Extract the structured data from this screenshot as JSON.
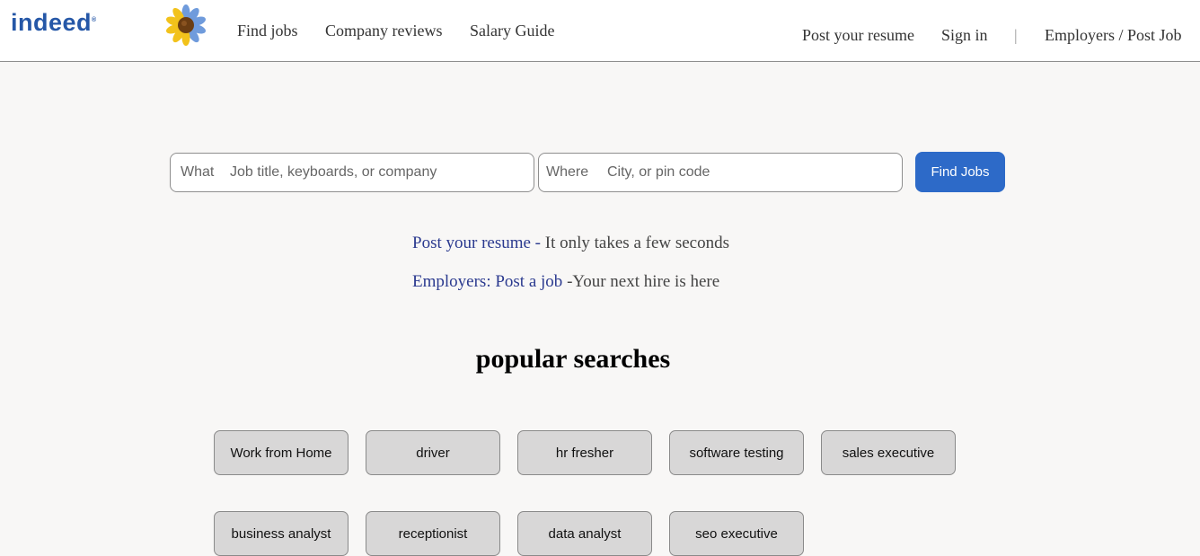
{
  "header": {
    "logo_text": "indeed",
    "logo_mark": "®",
    "nav_left": [
      {
        "label": "Find jobs"
      },
      {
        "label": "Company reviews"
      },
      {
        "label": "Salary Guide"
      }
    ],
    "nav_right": {
      "post_resume": "Post your resume",
      "sign_in": "Sign in",
      "separator": "|",
      "employers": "Employers / Post Job"
    }
  },
  "search": {
    "what_label": "What",
    "what_placeholder": "Job title, keyboards, or company",
    "where_label": "Where",
    "where_placeholder": "City, or pin code",
    "button_label": "Find Jobs"
  },
  "promos": {
    "resume_link": "Post your resume -",
    "resume_text": " It only takes a few seconds",
    "employer_link": "Employers: Post a job",
    "employer_text": " -Your next hire is here"
  },
  "popular": {
    "title": "popular searches",
    "row1": [
      "Work from Home",
      "driver",
      "hr fresher",
      "software testing",
      "sales executive"
    ],
    "row2": [
      "business analyst",
      "receptionist",
      "data analyst",
      "seo executive"
    ]
  },
  "colors": {
    "brand_blue": "#2557a7",
    "button_blue": "#2d6ac8",
    "link_navy": "#2b3a8f",
    "page_bg": "#f8f7f6",
    "chip_bg": "#d8d7d7"
  }
}
